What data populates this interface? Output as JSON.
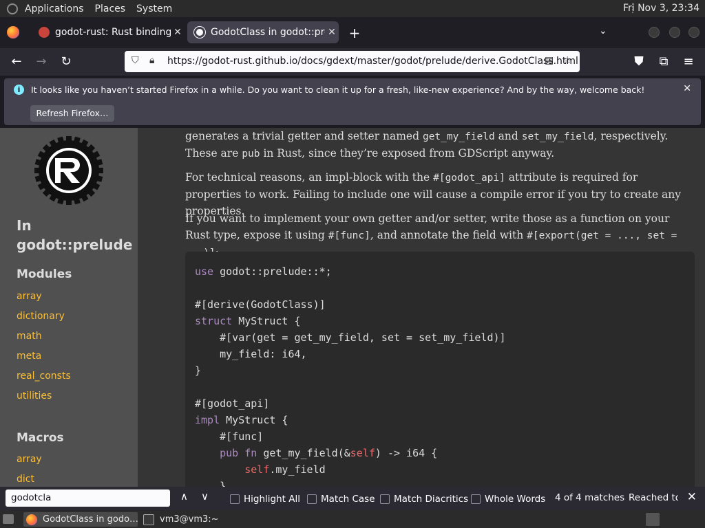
{
  "system_panel": {
    "menus": [
      "Applications",
      "Places",
      "System"
    ],
    "clock": "Fri Nov 3, 23:34"
  },
  "tabs": [
    {
      "title": "godot-rust: Rust bindings for Godot",
      "active": false
    },
    {
      "title": "GodotClass in godot::prelude",
      "active": true
    }
  ],
  "navbar": {
    "url": "https://godot-rust.github.io/docs/gdext/master/godot/prelude/derive.GodotClass.html"
  },
  "notification": {
    "message": "It looks like you haven’t started Firefox in a while. Do you want to clean it up for a fresh, like-new experience? And by the way, welcome back!",
    "button": "Refresh Firefox…"
  },
  "sidebar": {
    "heading_line1": "In",
    "heading_line2": "godot::prelude",
    "modules_title": "Modules",
    "modules": [
      "array",
      "dictionary",
      "math",
      "meta",
      "real_consts",
      "utilities"
    ],
    "macros_title": "Macros",
    "macros": [
      "array",
      "dict"
    ]
  },
  "content": {
    "p1a": "generates a trivial getter and setter named ",
    "p1_code1": "get_my_field",
    "p1b": " and ",
    "p1_code2": "set_my_field",
    "p1c": ", respectively. These are ",
    "p1_code3": "pub",
    "p1d": " in Rust, since they’re exposed from GDScript anyway.",
    "p2a": "For technical reasons, an impl-block with the ",
    "p2_code": "#[godot_api]",
    "p2b": " attribute is required for properties to work. Failing to include one will cause a compile error if you try to create any properties.",
    "p3a": "If you want to implement your own getter and/or setter, write those as a function on your Rust type, expose it using ",
    "p3_code1": "#[func]",
    "p3b": ", and annotate the field with ",
    "p3_code2": "#[export(get = ..., set = ...)]",
    "p3c": ":"
  },
  "code": {
    "l1_kw": "use",
    "l1_rest": " godot::prelude::*;",
    "l2": "#[derive(GodotClass)]",
    "l3_kw": "struct",
    "l3_rest": " MyStruct {",
    "l4": "    #[var(get = get_my_field, set = set_my_field)]",
    "l5": "    my_field: i64,",
    "l6": "}",
    "l7": "#[godot_api]",
    "l8_kw": "impl",
    "l8_rest": " MyStruct {",
    "l9": "    #[func]",
    "l10_kw1": "pub",
    "l10_kw2": "fn",
    "l10_rest_a": " get_my_field(&",
    "l10_self": "self",
    "l10_rest_b": ") -> i64 {",
    "l11_self": "self",
    "l11_rest": ".my_field",
    "l12": "    }"
  },
  "findbar": {
    "query": "godotcla",
    "highlight_all": "Highlight All",
    "match_case": "Match Case",
    "match_diacritics": "Match Diacritics",
    "whole_words": "Whole Words",
    "match_count": "4 of 4 matches",
    "reached": "Reached top"
  },
  "taskbar": {
    "task1": "GodotClass in godo…",
    "task2": "vm3@vm3:~"
  },
  "colors": {
    "link": "#fdbf35",
    "sidebar_bg": "#505050",
    "content_bg": "#353535",
    "code_bg": "#2a2a2a"
  }
}
